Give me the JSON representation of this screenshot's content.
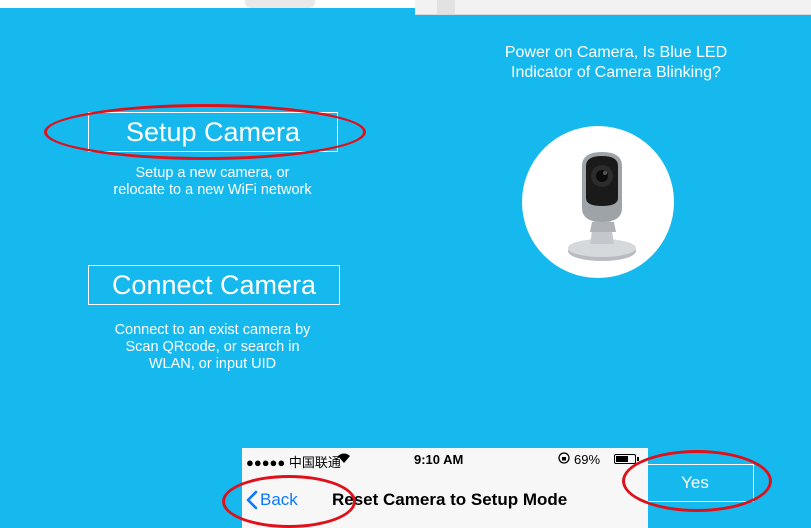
{
  "setup": {
    "label": "Setup Camera",
    "description": "Setup a new camera, or\nrelocate to a new WiFi network"
  },
  "connect": {
    "label": "Connect Camera",
    "description": "Connect to an exist camera by\nScan QRcode, or search in\nWLAN, or  input UID"
  },
  "question": "Power on Camera, Is Blue LED\nIndicator of Camera Blinking?",
  "yes_label": "Yes",
  "status_bar": {
    "carrier": "●●●●● 中国联通",
    "time": "9:10 AM",
    "battery_pct": "69%",
    "battery_level": 0.69
  },
  "nav": {
    "back_label": "Back",
    "title": "Reset Camera to Setup Mode"
  },
  "icons": {
    "wifi": "wifi-icon",
    "rotation_lock": "rotation-lock-icon",
    "battery": "battery-icon",
    "back_chevron": "chevron-left-icon",
    "camera": "camera-image"
  },
  "colors": {
    "panel_background": "#16b9ee",
    "ios_blue": "#0a7aff",
    "annotation_red": "#e0101a"
  }
}
